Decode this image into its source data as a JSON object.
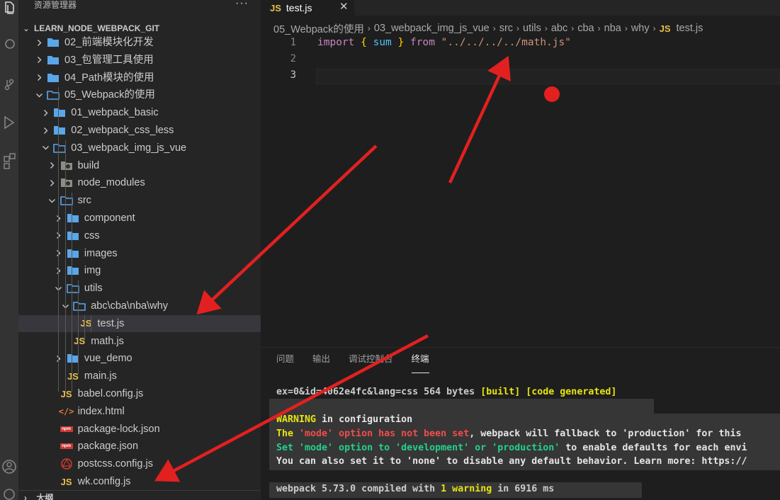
{
  "sidebar": {
    "title": "资源管理器",
    "more": "···",
    "section_title": "LEARN_NODE_WEBPACK_GIT",
    "outline_title": "大纲",
    "items": [
      {
        "label": "02_前端模块化开发",
        "type": "folder"
      },
      {
        "label": "03_包管理工具使用",
        "type": "folder"
      },
      {
        "label": "04_Path模块的使用",
        "type": "folder"
      },
      {
        "label": "05_Webpack的使用",
        "type": "folder-open"
      },
      {
        "label": "01_webpack_basic",
        "type": "folder"
      },
      {
        "label": "02_webpack_css_less",
        "type": "folder"
      },
      {
        "label": "03_webpack_img_js_vue",
        "type": "folder-open"
      },
      {
        "label": "build",
        "type": "folder-special"
      },
      {
        "label": "node_modules",
        "type": "folder-special"
      },
      {
        "label": "src",
        "type": "folder-open"
      },
      {
        "label": "component",
        "type": "folder"
      },
      {
        "label": "css",
        "type": "folder"
      },
      {
        "label": "images",
        "type": "folder"
      },
      {
        "label": "img",
        "type": "folder"
      },
      {
        "label": "utils",
        "type": "folder-open"
      },
      {
        "label": "abc\\cba\\nba\\why",
        "type": "folder-open"
      },
      {
        "label": "test.js",
        "type": "js",
        "selected": true
      },
      {
        "label": "math.js",
        "type": "js"
      },
      {
        "label": "vue_demo",
        "type": "folder"
      },
      {
        "label": "main.js",
        "type": "js"
      },
      {
        "label": "babel.config.js",
        "type": "js"
      },
      {
        "label": "index.html",
        "type": "html"
      },
      {
        "label": "package-lock.json",
        "type": "npm"
      },
      {
        "label": "package.json",
        "type": "npm"
      },
      {
        "label": "postcss.config.js",
        "type": "postcss"
      },
      {
        "label": "wk.config.js",
        "type": "js"
      }
    ]
  },
  "editor": {
    "tab_label": "test.js",
    "tab_icon": "JS",
    "tab_close": "✕",
    "breadcrumb": [
      "05_Webpack的使用",
      "03_webpack_img_js_vue",
      "src",
      "utils",
      "abc",
      "cba",
      "nba",
      "why"
    ],
    "breadcrumb_file": "test.js",
    "line_numbers": [
      "1",
      "2",
      "3"
    ],
    "code": {
      "import_kw": "import",
      "open_brace": "{",
      "var_name": "sum",
      "close_brace": "}",
      "from_kw": "from",
      "path": "\"../../../../math.js\""
    }
  },
  "panel": {
    "tabs": [
      "问题",
      "输出",
      "调试控制台",
      "终端"
    ],
    "active_tab": "终端",
    "terminal": {
      "line1_a": "ex=0&id=4062e4fc&lang=css 564 bytes ",
      "line1_b": "[built]",
      "line1_c": " ",
      "line1_d": "[code generated]",
      "line2_a": "WARNING",
      "line2_b": " in configuration",
      "line3_a": "The ",
      "line3_b": "'mode' option has not been set",
      "line3_c": ", webpack will fallback to 'production' for this",
      "line4_a": "Set 'mode' option to 'development' or 'production'",
      "line4_b": " to enable defaults for each envi",
      "line5": "You can also set it to 'none' to disable any default behavior. Learn more: https://",
      "line6_a": "webpack 5.73.0 compiled with ",
      "line6_b": "1 warning",
      "line6_c": " in 6916 ms"
    }
  },
  "colors": {
    "annotation_red": "#e32020",
    "js_icon": "#e8c04a",
    "folder_blue": "#5aa6e8"
  }
}
